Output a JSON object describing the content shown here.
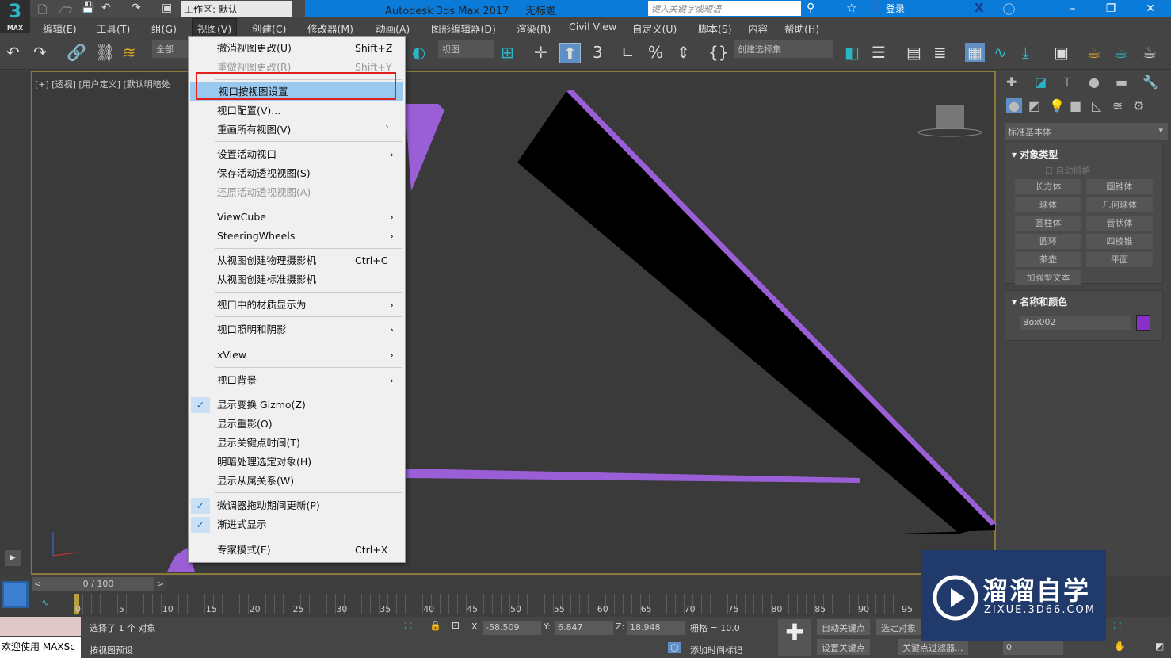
{
  "app": {
    "logo": "3",
    "logo_sub": "MAX",
    "title": "Autodesk 3ds Max 2017",
    "doc": "无标题",
    "workspace": "工作区: 默认",
    "search_placeholder": "键入关键字或短语",
    "login": "登录"
  },
  "menubar": [
    "编辑(E)",
    "工具(T)",
    "组(G)",
    "视图(V)",
    "创建(C)",
    "修改器(M)",
    "动画(A)",
    "图形编辑器(D)",
    "渲染(R)",
    "Civil View",
    "自定义(U)",
    "脚本(S)",
    "内容",
    "帮助(H)"
  ],
  "toolbar": {
    "filter": "全部",
    "refcoord": "视图",
    "selset": "创建选择集"
  },
  "viewport": {
    "label": "[+] [透视] [用户定义] [默认明暗处"
  },
  "view_menu": [
    {
      "label": "撤消视图更改(U)",
      "shortcut": "Shift+Z"
    },
    {
      "label": "重做视图更改(R)",
      "shortcut": "Shift+Y",
      "disabled": true
    },
    {
      "label": "视口按视图设置",
      "highlighted": true
    },
    {
      "label": "视口配置(V)..."
    },
    {
      "label": "重画所有视图(V)",
      "shortcut": "`"
    },
    {
      "label": "设置活动视口",
      "submenu": true
    },
    {
      "label": "保存活动透视视图(S)"
    },
    {
      "label": "还原活动透视视图(A)",
      "disabled": true
    },
    {
      "label": "ViewCube",
      "submenu": true
    },
    {
      "label": "SteeringWheels",
      "submenu": true
    },
    {
      "label": "从视图创建物理摄影机",
      "shortcut": "Ctrl+C"
    },
    {
      "label": "从视图创建标准摄影机"
    },
    {
      "label": "视口中的材质显示为",
      "submenu": true
    },
    {
      "label": "视口照明和阴影",
      "submenu": true
    },
    {
      "label": "xView",
      "submenu": true
    },
    {
      "label": "视口背景",
      "submenu": true
    },
    {
      "label": "显示变换 Gizmo(Z)",
      "checked": true
    },
    {
      "label": "显示重影(O)"
    },
    {
      "label": "显示关键点时间(T)"
    },
    {
      "label": "明暗处理选定对象(H)"
    },
    {
      "label": "显示从属关系(W)"
    },
    {
      "label": "微调器拖动期间更新(P)",
      "checked": true
    },
    {
      "label": "渐进式显示",
      "checked": true
    },
    {
      "label": "专家模式(E)",
      "shortcut": "Ctrl+X"
    }
  ],
  "command_panel": {
    "category": "标准基本体",
    "object_type_title": "对象类型",
    "autogrid": "自动栅格",
    "objects": [
      "长方体",
      "圆锥体",
      "球体",
      "几何球体",
      "圆柱体",
      "管状体",
      "圆环",
      "四棱锥",
      "茶壶",
      "平面",
      "加强型文本"
    ],
    "name_color_title": "名称和颜色",
    "object_name": "Box002",
    "object_color": "#8a2fc9"
  },
  "timeline": {
    "frame": "0 / 100",
    "ticks": [
      "0",
      "5",
      "10",
      "15",
      "20",
      "25",
      "30",
      "35",
      "40",
      "45",
      "50",
      "55",
      "60",
      "65",
      "70",
      "75",
      "80",
      "85",
      "90",
      "95"
    ]
  },
  "status": {
    "maxscript": "欢迎使用 MAXSc",
    "selected": "选择了 1 个 对象",
    "prompt": "按视图预设",
    "x_label": "X:",
    "x": "-58.509",
    "y_label": "Y:",
    "y": "6.847",
    "z_label": "Z:",
    "z": "18.948",
    "grid": "栅格 = 10.0",
    "add_time_tag": "添加时间标记",
    "auto_key": "自动关键点",
    "selected_obj": "选定对象",
    "set_key": "设置关键点",
    "key_filters": "关键点过滤器...",
    "frame_value": "0"
  },
  "watermark": {
    "name": "溜溜自学",
    "url": "ZIXUE.3D66.COM"
  },
  "colors": {
    "accent": "#0a7bd8",
    "highlight": "#99c9ef",
    "red_box": "#e02020",
    "object": "#8a2fc9"
  }
}
